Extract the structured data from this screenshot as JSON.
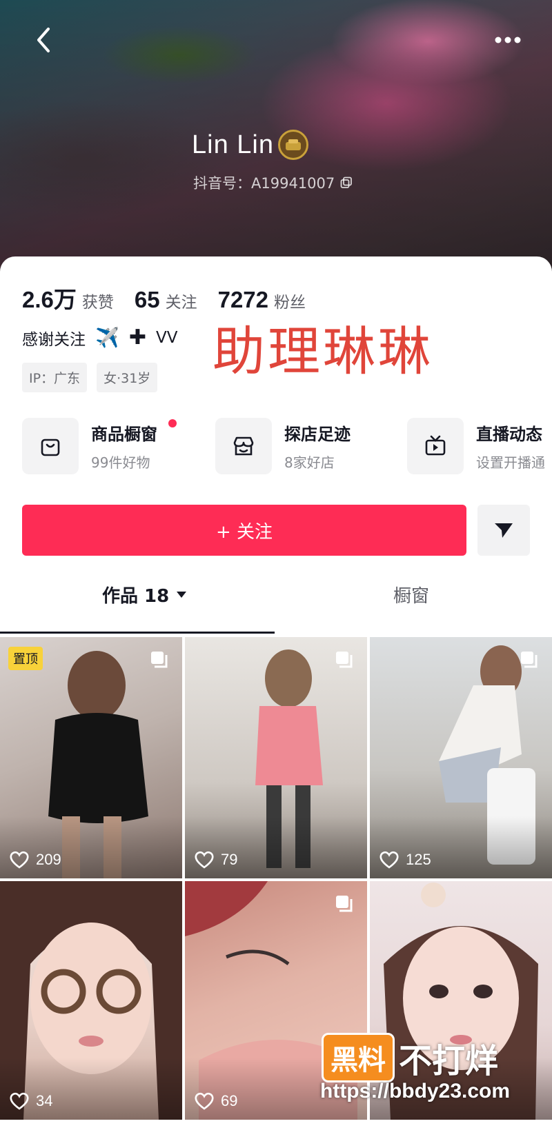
{
  "header": {
    "nickname": "Lin Lin",
    "douyin_id": "抖音号：A19941007",
    "back_icon": "chevron-left-icon",
    "more_icon": "more-horizontal-icon"
  },
  "stats": [
    {
      "value": "2.6万",
      "label": "获赞"
    },
    {
      "value": "65",
      "label": "关注"
    },
    {
      "value": "7272",
      "label": "粉丝"
    }
  ],
  "bio": {
    "text": "感谢关注",
    "emoji": "✈️",
    "plus": "✚",
    "suffix": "VV",
    "overlay_text": "助理琳琳"
  },
  "tags": [
    "IP：广东",
    "女·31岁"
  ],
  "features": [
    {
      "title": "商品橱窗",
      "subtitle": "99件好物",
      "icon": "shopping-bag-icon",
      "has_dot": true
    },
    {
      "title": "探店足迹",
      "subtitle": "8家好店",
      "icon": "store-icon",
      "has_dot": false
    },
    {
      "title": "直播动态",
      "subtitle": "设置开播通",
      "icon": "tv-play-icon",
      "has_dot": false
    }
  ],
  "actions": {
    "follow_label": "+ 关注",
    "share_icon": "share-arrow-icon"
  },
  "tabs": {
    "works_label": "作品 18",
    "showcase_label": "橱窗"
  },
  "posts": [
    {
      "likes": "209",
      "pinned_label": "置顶",
      "multi": true
    },
    {
      "likes": "79",
      "multi": true
    },
    {
      "likes": "125",
      "multi": true
    },
    {
      "likes": "34",
      "multi": false
    },
    {
      "likes": "69",
      "multi": true
    },
    {
      "likes": "",
      "multi": false
    }
  ],
  "watermark": {
    "box_text": "黑料",
    "text": "不打烊",
    "url": "https://bbdy23.com"
  },
  "colors": {
    "accent": "#fe2c55",
    "overlay_red": "#e0453a",
    "pin_yellow": "#f8d23a"
  }
}
